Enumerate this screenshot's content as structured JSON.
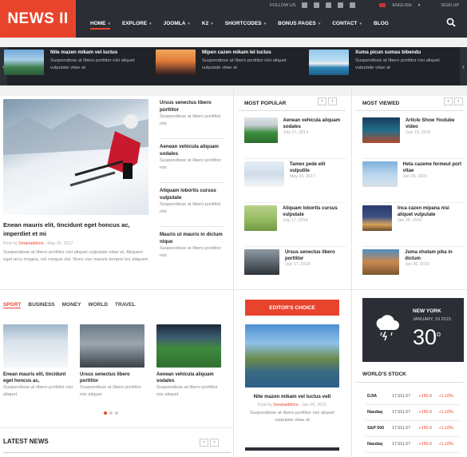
{
  "brand": {
    "logo": "NEWS II"
  },
  "topbar": {
    "follow": "FOLLOW US",
    "lang": "ENGLISH",
    "signup": "SIGN UP"
  },
  "nav": {
    "items": [
      {
        "label": "HOME",
        "caret": true
      },
      {
        "label": "EXPLORE",
        "caret": true
      },
      {
        "label": "JOOMLA",
        "caret": true
      },
      {
        "label": "K2",
        "caret": true
      },
      {
        "label": "SHORTCODES",
        "caret": true
      },
      {
        "label": "BONUS PAGES",
        "caret": true
      },
      {
        "label": "CONTACT",
        "caret": true
      },
      {
        "label": "BLOG",
        "caret": false
      }
    ]
  },
  "ticker": [
    {
      "title": "Nite mazen mikam vel luctus",
      "text": "Suspendisse at libero porttitor nisi aliquet vulputate vitae at"
    },
    {
      "title": "Mipen cazen mikam lel luctus",
      "text": "Suspendisse at libero porttitor nisi aliquet vulputate vitae at"
    },
    {
      "title": "Xuma picun sumas bibendu",
      "text": "Suspendisse at libero porttitor nisi aliquet vulputate vitae at"
    }
  ],
  "feature": {
    "title": "Enean mauris elit, tincidunt eget honcus ac, imperdiet et mi",
    "meta_prefix": "Post by",
    "author": "Smartaddons",
    "date": "May 26, 2017",
    "text": "Suspendisse at libero porttitor nisi aliquet vulputate vitae at. Aliquam eget arcu magna, vel congue dui. Nunc nec mauris tempor les aliquam"
  },
  "side_list": [
    {
      "title": "Ursus senectus libero porttitor",
      "text": "Suspendisse at libero porttitor nisi"
    },
    {
      "title": "Aenean vehicula aliquam sodales",
      "text": "Suspendisse at libero porttitor nisi"
    },
    {
      "title": "Aliquam lobortis cursus vulputate",
      "text": "Suspendisse at libero porttitor nisi"
    },
    {
      "title": "Mauris ut mauris in dictum nique",
      "text": "Suspendisse at libero porttitor nisi"
    }
  ],
  "most_popular": {
    "heading": "MOST POPULAR",
    "items": [
      {
        "title": "Aenean vehicula aliquam sodales",
        "date": "July 17, 2014"
      },
      {
        "title": "Tamex pede elit vulputite",
        "date": "May 26, 2017"
      },
      {
        "title": "Aliquam lobortis cursus vulputate",
        "date": "July 17, 2014"
      },
      {
        "title": "Ursus senectus libero porttitor",
        "date": "July 17, 2014"
      }
    ]
  },
  "most_viewed": {
    "heading": "MOST VIEWED",
    "items": [
      {
        "title": "Article Show Youtube video",
        "date": "July 10, 2016"
      },
      {
        "title": "Heta cazeme fermeut port vitae",
        "date": "Jan 26, 2016"
      },
      {
        "title": "Inca cazen mipana nisi aliquet vulputate",
        "date": "Jan 26, 2016"
      },
      {
        "title": "Juma xhutam pika in dictum",
        "date": "Jan 26, 2016"
      }
    ]
  },
  "categories": {
    "tabs": [
      "SPORT",
      "BUSINESS",
      "MONEY",
      "WORLD",
      "TRAVEL"
    ],
    "items": [
      {
        "title": "Enean mauris elit, tincidunt eget honcus ac,",
        "text": "Suspendisse at libero porttitor nisi aliquet"
      },
      {
        "title": "Ursus senectus libero porttitor",
        "text": "Suspendisse at libero porttitor nisi aliquet"
      },
      {
        "title": "Aenean vehicula aliquam sodales",
        "text": "Suspendisse at libero porttitor nisi aliquet"
      }
    ]
  },
  "editor": {
    "heading": "EDITOR'S CHOICE",
    "title": "Nite mazen mikam vel luctus velt",
    "meta_prefix": "Post by",
    "author": "Smartaddons",
    "date": "Jan 26, 2015",
    "text": "Suspendisse at libero porttitor nisi aliquet vulputate vitae at"
  },
  "weather": {
    "city": "NEW YORK",
    "date": "JANUARY, 19 2015",
    "temp": "30",
    "unit": "o"
  },
  "stocks": {
    "heading": "WORLD'S STOCK",
    "rows": [
      {
        "name": "DJIA",
        "price": "17,511.57",
        "change": "+150.0",
        "pct": "+1.10%"
      },
      {
        "name": "Nasdaq",
        "price": "17,511.57",
        "change": "+150.0",
        "pct": "+1.10%"
      },
      {
        "name": "S&P 500",
        "price": "17,511.57",
        "change": "+150.0",
        "pct": "+1.10%"
      },
      {
        "name": "Nasdaq",
        "price": "17,511.57",
        "change": "+150.0",
        "pct": "+1.10%"
      }
    ]
  },
  "latest": {
    "heading": "LATEST NEWS"
  },
  "colors": {
    "accent": "#e8442d",
    "dark": "#23262d"
  }
}
